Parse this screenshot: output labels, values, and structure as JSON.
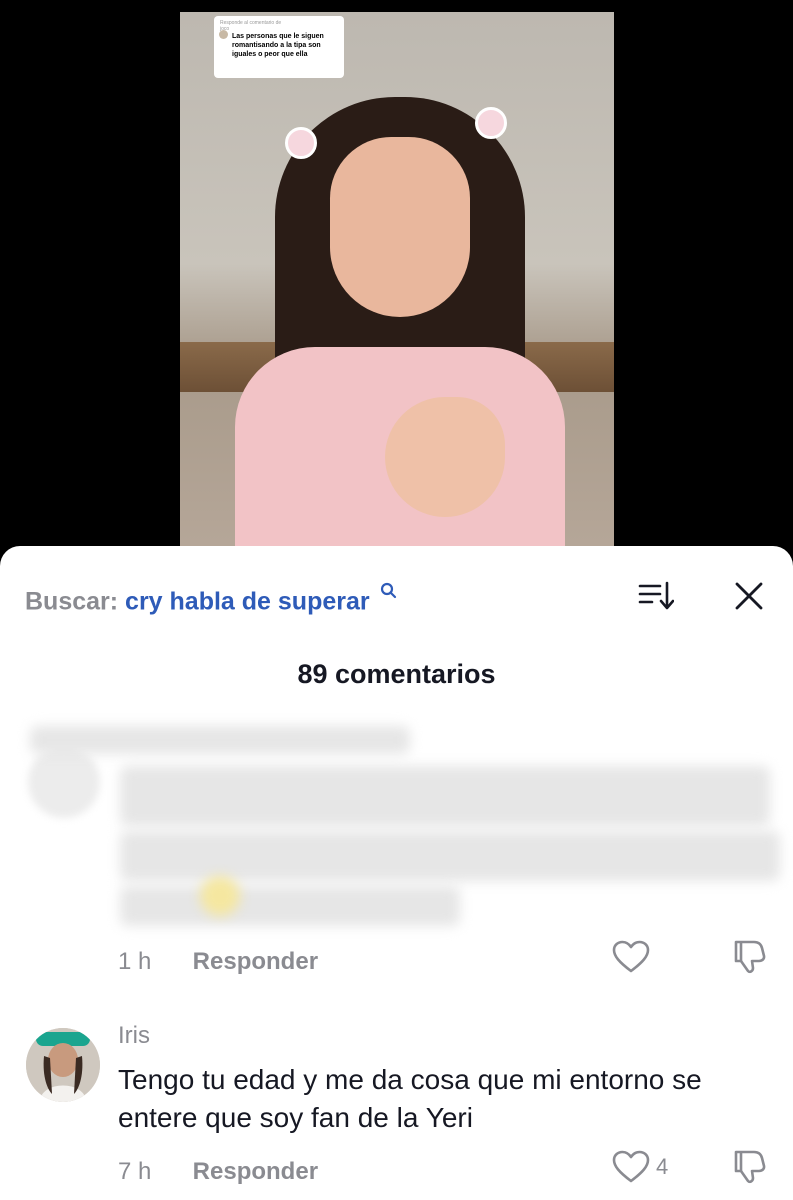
{
  "video": {
    "reply_sticker": {
      "header": "Responde al comentario de",
      "username": "joco",
      "text": "Las personas que le siguen romantisando a la tipa son iguales o peor que ella"
    }
  },
  "sheet": {
    "search_label": "Buscar:",
    "search_query": "cry habla de superar",
    "comment_count": "89 comentarios",
    "icons": {
      "search": "search-icon",
      "sort": "sort-icon",
      "close": "close-icon"
    }
  },
  "comments": [
    {
      "blurred": true,
      "time": "1 h",
      "reply_label": "Responder",
      "likes": ""
    },
    {
      "blurred": false,
      "username": "Iris",
      "text": "Tengo tu edad y me da cosa que mi entorno se entere que soy fan de la Yeri",
      "time": "7 h",
      "reply_label": "Responder",
      "likes": "4"
    }
  ],
  "colors": {
    "query_blue": "#2e5bb8",
    "muted_gray": "#8a8b91",
    "text_dark": "#161823"
  }
}
